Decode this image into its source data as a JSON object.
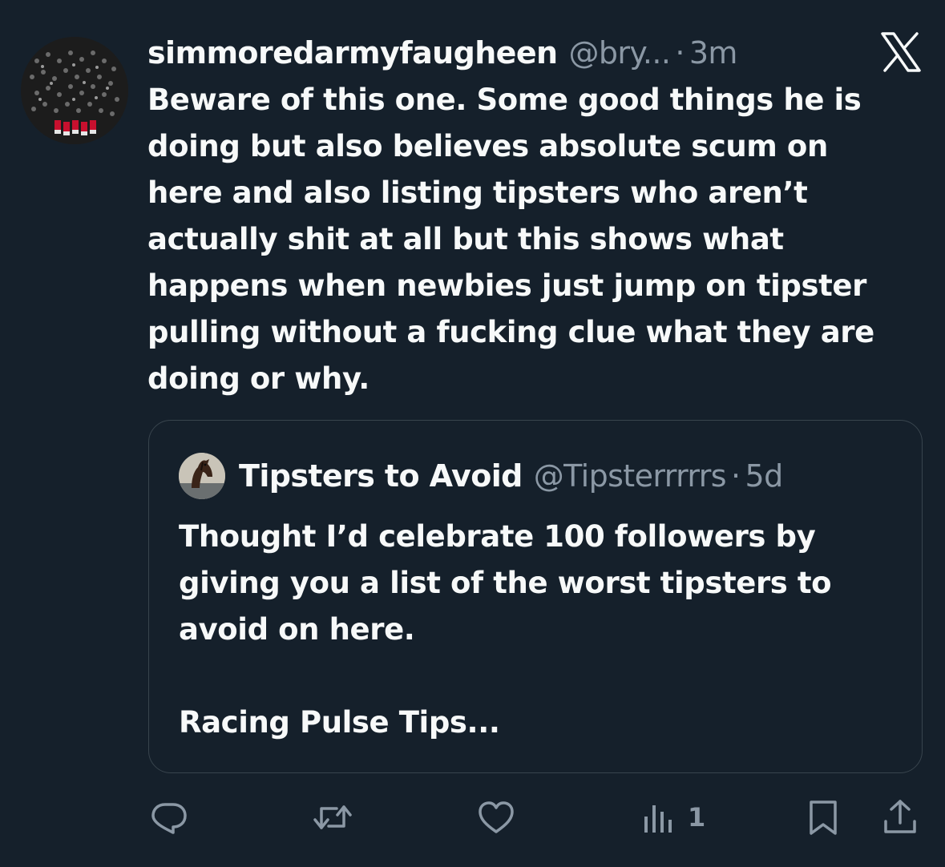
{
  "tweet": {
    "display_name": "simmoredarmyfaugheen",
    "handle": "@bry...",
    "separator": "·",
    "time": "3m",
    "text": "Beware of this one. Some good things he is\ndoing but also believes absolute scum on\nhere and also listing tipsters who aren’t\nactually shit at all but this shows what\nhappens when newbies just jump on tipster\npulling without a fucking clue what they are\ndoing or why."
  },
  "quote": {
    "display_name": "Tipsters to Avoid",
    "handle": "@Tipsterrrrrs",
    "separator": "·",
    "time": "5d",
    "text": "Thought I’d celebrate 100 followers by\ngiving you a list of the worst tipsters to\navoid on here.\n\nRacing Pulse Tips..."
  },
  "actions": {
    "reply_icon": "reply-icon",
    "retweet_icon": "retweet-icon",
    "like_icon": "like-icon",
    "views_icon": "views-icon",
    "views_count": "1",
    "bookmark_icon": "bookmark-icon",
    "share_icon": "share-icon"
  },
  "colors": {
    "background": "#15202b",
    "primary_text": "#f7f9f9",
    "secondary_text": "#8b98a5",
    "border": "#38444d"
  }
}
